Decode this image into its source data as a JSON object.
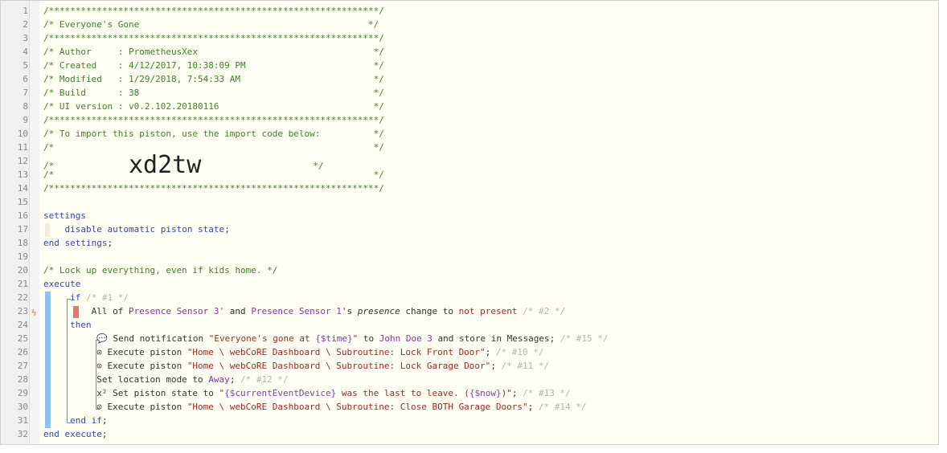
{
  "lines": [
    {
      "n": "1",
      "s": [
        {
          "c": "c",
          "t": "/**************************************************************/"
        }
      ]
    },
    {
      "n": "2",
      "s": [
        {
          "c": "c",
          "t": "/* Everyone's Gone                                           */"
        }
      ]
    },
    {
      "n": "3",
      "s": [
        {
          "c": "c",
          "t": "/**************************************************************/"
        }
      ]
    },
    {
      "n": "4",
      "s": [
        {
          "c": "c",
          "t": "/* Author     : PrometheusXex                                 */"
        }
      ]
    },
    {
      "n": "5",
      "s": [
        {
          "c": "c",
          "t": "/* Created    : 4/12/2017, 10:38:09 PM                        */"
        }
      ]
    },
    {
      "n": "6",
      "s": [
        {
          "c": "c",
          "t": "/* Modified   : 1/29/2018, 7:54:33 AM                         */"
        }
      ]
    },
    {
      "n": "7",
      "s": [
        {
          "c": "c",
          "t": "/* Build      : 38                                            */"
        }
      ]
    },
    {
      "n": "8",
      "s": [
        {
          "c": "c",
          "t": "/* UI version : v0.2.102.20180116                             */"
        }
      ]
    },
    {
      "n": "9",
      "s": [
        {
          "c": "c",
          "t": "/**************************************************************/"
        }
      ]
    },
    {
      "n": "10",
      "s": [
        {
          "c": "c",
          "t": "/* To import this piston, use the import code below:          */"
        }
      ]
    },
    {
      "n": "11",
      "s": [
        {
          "c": "c",
          "t": "/*                                                            */"
        }
      ]
    },
    {
      "n": "12",
      "s": [
        {
          "c": "c",
          "t": "/*              "
        },
        {
          "c": "big",
          "t": "xd2tw"
        },
        {
          "c": "c",
          "t": "                     */"
        }
      ]
    },
    {
      "n": "13",
      "s": [
        {
          "c": "c",
          "t": "/*                                                            */"
        }
      ]
    },
    {
      "n": "14",
      "s": [
        {
          "c": "c",
          "t": "/**************************************************************/"
        }
      ]
    },
    {
      "n": "15",
      "s": []
    },
    {
      "n": "16",
      "s": [
        {
          "c": "kw",
          "t": "settings"
        }
      ]
    },
    {
      "n": "17",
      "s": [
        {
          "c": "",
          "t": "    "
        },
        {
          "c": "kw",
          "t": "disable automatic piston state"
        },
        {
          "c": "",
          "t": ";"
        }
      ]
    },
    {
      "n": "18",
      "s": [
        {
          "c": "kw",
          "t": "end settings"
        },
        {
          "c": "",
          "t": ";"
        }
      ]
    },
    {
      "n": "19",
      "s": []
    },
    {
      "n": "20",
      "s": [
        {
          "c": "c",
          "t": "/* Lock up everything, even if kids home. */"
        }
      ]
    },
    {
      "n": "21",
      "s": [
        {
          "c": "kw",
          "t": "execute"
        }
      ]
    },
    {
      "n": "22",
      "s": [
        {
          "c": "",
          "t": "     "
        },
        {
          "c": "kw",
          "t": "if"
        },
        {
          "c": "cm",
          "t": " /* #1 */"
        }
      ]
    },
    {
      "n": "23",
      "s": [
        {
          "c": "",
          "t": "         All of "
        },
        {
          "c": "dev",
          "t": "Presence Sensor 3'"
        },
        {
          "c": "",
          "t": " and "
        },
        {
          "c": "dev",
          "t": "Presence Sensor 1"
        },
        {
          "c": "",
          "t": "'s "
        },
        {
          "c": "em",
          "t": "presence"
        },
        {
          "c": "",
          "t": " change to "
        },
        {
          "c": "str",
          "t": "not present"
        },
        {
          "c": "cm",
          "t": " /* #2 */"
        }
      ]
    },
    {
      "n": "24",
      "s": [
        {
          "c": "",
          "t": "     "
        },
        {
          "c": "kw",
          "t": "then"
        }
      ]
    },
    {
      "n": "25",
      "s": [
        {
          "c": "",
          "t": "          💬 Send notification "
        },
        {
          "c": "str",
          "t": "\"Everyone's gone at "
        },
        {
          "c": "v",
          "t": "{$time}"
        },
        {
          "c": "str",
          "t": "\""
        },
        {
          "c": "",
          "t": " to "
        },
        {
          "c": "dev",
          "t": "John Doe 3"
        },
        {
          "c": "",
          "t": " and store in Messages;"
        },
        {
          "c": "cm",
          "t": " /* #15 */"
        }
      ]
    },
    {
      "n": "26",
      "s": [
        {
          "c": "",
          "t": "          ⊙ Execute piston "
        },
        {
          "c": "str",
          "t": "\"Home \\ webCoRE Dashboard \\ Subroutine: Lock Front Door\""
        },
        {
          "c": "",
          "t": ";"
        },
        {
          "c": "cm",
          "t": " /* #10 */"
        }
      ]
    },
    {
      "n": "27",
      "s": [
        {
          "c": "",
          "t": "          ⊙ Execute piston "
        },
        {
          "c": "str",
          "t": "\"Home \\ webCoRE Dashboard \\ Subroutine: Lock Garage Door\""
        },
        {
          "c": "",
          "t": ";"
        },
        {
          "c": "cm",
          "t": " /* #11 */"
        }
      ]
    },
    {
      "n": "28",
      "s": [
        {
          "c": "",
          "t": "          Set location mode to "
        },
        {
          "c": "dev",
          "t": "Away"
        },
        {
          "c": "",
          "t": ";"
        },
        {
          "c": "cm",
          "t": " /* #12 */"
        }
      ]
    },
    {
      "n": "29",
      "s": [
        {
          "c": "",
          "t": "          x² Set piston state to "
        },
        {
          "c": "str",
          "t": "\""
        },
        {
          "c": "v",
          "t": "{$currentEventDevice}"
        },
        {
          "c": "str",
          "t": " was the last to leave. ("
        },
        {
          "c": "v",
          "t": "{$now}"
        },
        {
          "c": "str",
          "t": ")\""
        },
        {
          "c": "",
          "t": ";"
        },
        {
          "c": "cm",
          "t": " /* #13 */"
        }
      ]
    },
    {
      "n": "30",
      "s": [
        {
          "c": "",
          "t": "          ⊙ Execute piston "
        },
        {
          "c": "str",
          "t": "\"Home \\ webCoRE Dashboard \\ Subroutine: Close BOTH Garage Doors\""
        },
        {
          "c": "",
          "t": ";"
        },
        {
          "c": "cm",
          "t": " /* #14 */"
        }
      ]
    },
    {
      "n": "31",
      "s": [
        {
          "c": "",
          "t": "     "
        },
        {
          "c": "kw",
          "t": "end if"
        },
        {
          "c": "",
          "t": ";"
        }
      ]
    },
    {
      "n": "32",
      "s": [
        {
          "c": "kw",
          "t": "end execute"
        },
        {
          "c": "",
          "t": ";"
        }
      ]
    }
  ],
  "markers": {
    "trigger_line": "23",
    "trigger_icon": "lightning-bolt-icon"
  },
  "colors": {
    "comment": "#3f7f30",
    "keyword": "#3344bb",
    "device": "#8833aa",
    "string": "#a02828",
    "variable": "#7a3fb0",
    "faded_comment": "#b4b4b4",
    "block_bar": "#8ec3f0"
  }
}
